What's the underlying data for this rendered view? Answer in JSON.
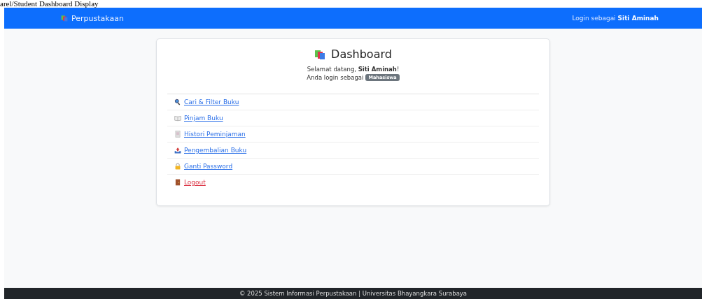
{
  "caption": "arel/Student Dashboard Display",
  "navbar": {
    "brand": "Perpustakaan",
    "login_prefix": "Login sebagai",
    "login_user": "Siti Aminah"
  },
  "card": {
    "title": "Dashboard",
    "welcome": "Selamat datang, **Siti Aminah**!",
    "role_prefix": "Anda login sebagai",
    "role_badge": "Mahasiswa",
    "links": [
      {
        "label": "Cari & Filter Buku",
        "kind": "normal"
      },
      {
        "label": "Pinjam Buku",
        "kind": "normal"
      },
      {
        "label": "Histori Peminjaman",
        "kind": "normal"
      },
      {
        "label": "Pengembalian Buku",
        "kind": "normal"
      },
      {
        "label": "Ganti Password",
        "kind": "normal"
      },
      {
        "label": "Logout",
        "kind": "danger"
      }
    ]
  },
  "footer": "© 2025 Sistem Informasi Perpustakaan | Universitas Bhayangkara Surabaya"
}
